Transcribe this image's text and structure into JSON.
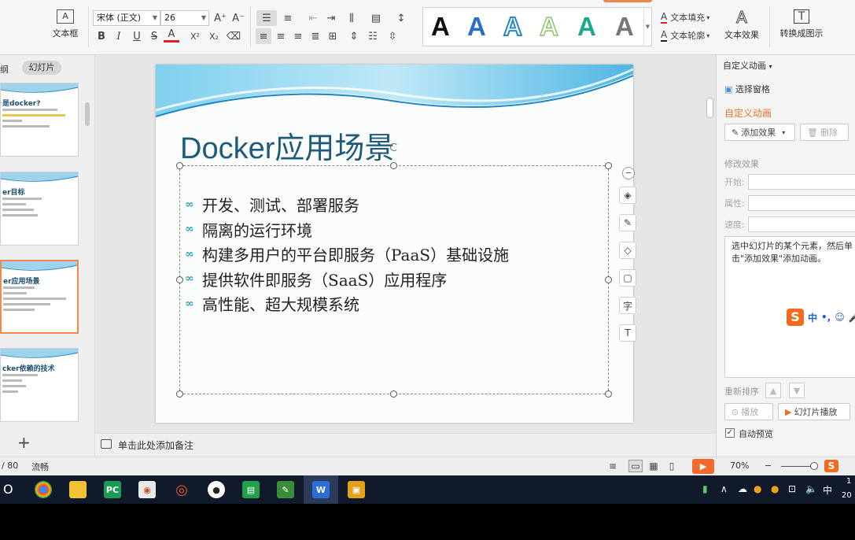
{
  "ribbon": {
    "textbox_label": "文本框",
    "font_name": "宋体 (正文)",
    "font_size": "26",
    "grow_font": "A⁺",
    "shrink_font": "A⁻",
    "bold": "B",
    "italic": "I",
    "underline": "U",
    "strike": "S",
    "font_color": "A",
    "superscript": "X²",
    "subscript": "X₂",
    "clear_format": "⌫",
    "wordart_letter": "A",
    "text_fill_label": "文本填充",
    "text_outline_label": "文本轮廓",
    "text_effect_label": "文本效果",
    "convert_label": "转换成图示"
  },
  "left_panel": {
    "outline_tab": "大纲",
    "slides_tab": "幻灯片",
    "thumbnails": [
      {
        "title": "是docker?"
      },
      {
        "title": "er目标"
      },
      {
        "title": "er应用场景"
      },
      {
        "title": "cker依赖的技术"
      }
    ],
    "add_slide": "+"
  },
  "slide": {
    "title": "Docker应用场景",
    "bullet_glyph": "∞",
    "bullets": [
      "开发、测试、部署服务",
      "隔离的运行环境",
      "构建多用户的平台即服务（PaaS）基础设施",
      "提供软件即服务（SaaS）应用程序",
      "高性能、超大规模系统"
    ]
  },
  "float_tools": {
    "collapse": "−",
    "layers": "◈",
    "pen": "✎",
    "fill": "◇",
    "border": "▢",
    "char": "字",
    "text_to": "T"
  },
  "notes": {
    "placeholder": "单击此处添加备注"
  },
  "right_panel": {
    "header": "自定义动画",
    "select_pane": "选择窗格",
    "section_title": "自定义动画",
    "add_effect": "添加效果",
    "delete": "删除",
    "modify_title": "修改效果",
    "start_label": "开始:",
    "property_label": "属性:",
    "speed_label": "速度:",
    "hint": "选中幻灯片的某个元素，然后单击\"添加效果\"添加动画。",
    "reorder_label": "重新排序",
    "play": "播放",
    "slideshow": "幻灯片播放",
    "auto_preview": "自动预览",
    "ime": {
      "logo": "S",
      "mode": "中",
      "punct": "•,",
      "emoji": "☺",
      "mic": "🎤"
    }
  },
  "status": {
    "page": "/ 80",
    "theme": "流畅",
    "zoom": "70%",
    "zoom_minus": "−"
  },
  "taskbar": {
    "search": "O",
    "lang": "中",
    "clock": "1",
    "date": "20"
  }
}
